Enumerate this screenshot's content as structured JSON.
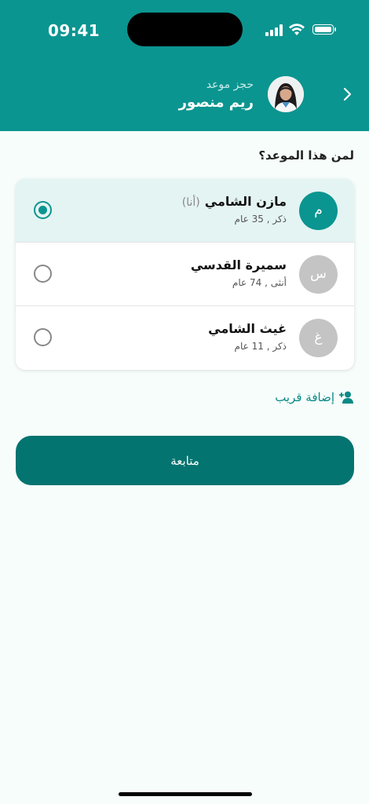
{
  "status_bar": {
    "time": "09:41"
  },
  "header": {
    "subtitle": "حجز موعد",
    "title": "ريم منصور",
    "back_icon": "chevron-right-icon"
  },
  "question": "لمن هذا الموعد؟",
  "patients": [
    {
      "initial": "م",
      "name": "مازن الشامي",
      "tag": "(أنا)",
      "meta": "ذكر , 35  عام",
      "avatar_color": "#0b9590",
      "selected": true
    },
    {
      "initial": "س",
      "name": "سميرة القدسي",
      "tag": "",
      "meta": "أنثى , 74  عام",
      "avatar_color": "#c4c4c4",
      "selected": false
    },
    {
      "initial": "غ",
      "name": "غيث الشامي",
      "tag": "",
      "meta": "ذكر , 11  عام",
      "avatar_color": "#c4c4c4",
      "selected": false
    }
  ],
  "add_relative": {
    "label": "إضافة قريب",
    "icon": "add-user-icon"
  },
  "continue_label": "متابعة",
  "colors": {
    "primary": "#0b9590",
    "button": "#037470",
    "selected_row": "#e4f4f3"
  }
}
